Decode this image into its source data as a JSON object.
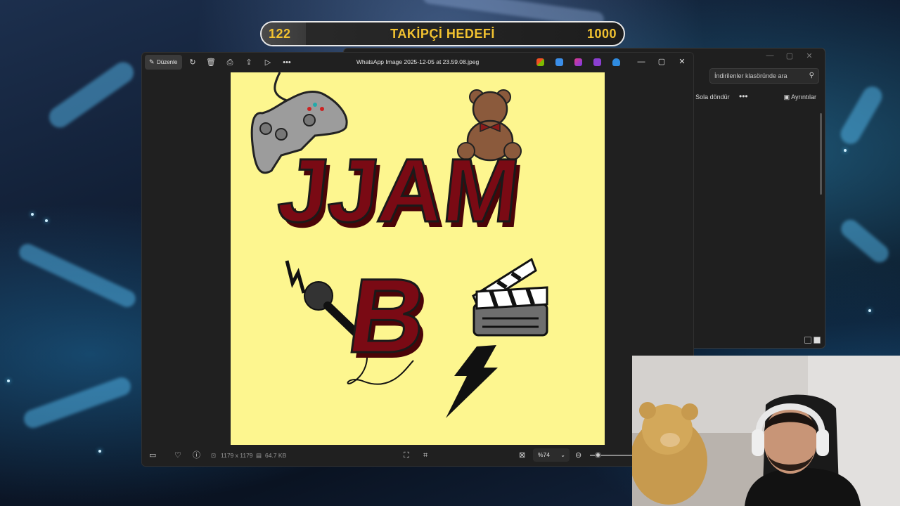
{
  "goal": {
    "current": "122",
    "label": "TAKİPÇİ HEDEFİ",
    "target": "1000",
    "progress_fraction": 0.122,
    "accent_color": "#f2c230"
  },
  "explorer": {
    "search_placeholder": "İndirilenler klasöründe ara",
    "rotate_left_label": "Sola döndür",
    "more_label": "•••",
    "details_label": "Ayrıntılar"
  },
  "viewer": {
    "edit_label": "Düzenle",
    "file_title": "WhatsApp Image 2025-12-05 at 23.59.08.jpeg",
    "more_label": "•••",
    "status": {
      "dimensions": "1179 x 1179",
      "file_size": "64.7 KB",
      "zoom_value": "%74"
    }
  },
  "artwork": {
    "title_text": "JJAM",
    "letter_text": "B",
    "background_color": "#fdf68f",
    "letter_color": "#7a0a14"
  }
}
